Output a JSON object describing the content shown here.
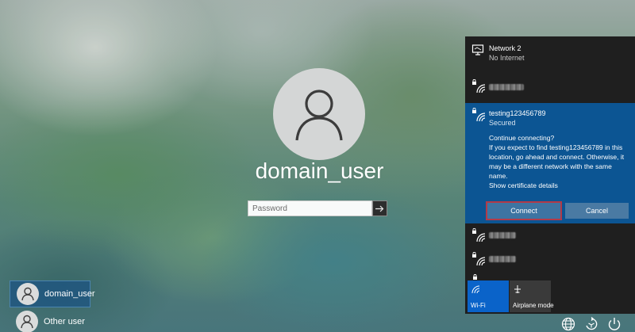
{
  "login": {
    "username": "domain_user",
    "password_placeholder": "Password"
  },
  "users": [
    {
      "name": "domain_user",
      "active": true
    },
    {
      "name": "Other user",
      "active": false
    }
  ],
  "network_flyout": {
    "connected": {
      "name": "Network 2",
      "status": "No Internet"
    },
    "selected_network": {
      "name": "testing123456789",
      "status": "Secured",
      "prompt_title": "Continue connecting?",
      "prompt_body": "If you expect to find testing123456789 in this location, go ahead and connect. Otherwise, it may be a different network with the same name.",
      "cert_link": "Show certificate details",
      "connect_label": "Connect",
      "cancel_label": "Cancel"
    },
    "quick_actions": [
      {
        "label": "Wi-Fi",
        "icon": "wifi-icon",
        "active": true
      },
      {
        "label": "Airplane mode",
        "icon": "airplane-icon",
        "active": false
      }
    ]
  },
  "system_icons": [
    "network-globe-icon",
    "ease-of-access-icon",
    "power-icon"
  ],
  "colors": {
    "accent": "#0c5593",
    "flyout_bg": "#1f1f1f",
    "wifi_tile": "#0a63c9",
    "connect_outline": "#b23a48"
  }
}
